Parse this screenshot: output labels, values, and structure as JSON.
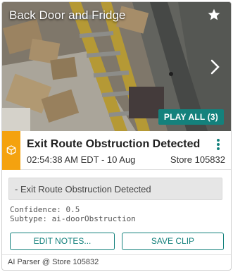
{
  "camera": {
    "title": "Back Door and Fridge",
    "play_all_label": "PLAY ALL (3)",
    "icons": {
      "favorite": "star-icon",
      "next": "chevron-right-icon"
    }
  },
  "event": {
    "title": "Exit Route Obstruction Detected",
    "time": "02:54:38 AM EDT - 10 Aug",
    "store": "Store 105832",
    "accent_color": "#f4a20f",
    "icons": {
      "type": "box-icon",
      "menu": "kebab-menu-icon"
    }
  },
  "details": {
    "notes": "- Exit Route Obstruction Detected",
    "confidence": "Confidence: 0.5",
    "subtype": "Subtype: ai-doorObstruction"
  },
  "actions": {
    "edit_notes_label": "EDIT NOTES...",
    "save_clip_label": "SAVE CLIP",
    "accent_color": "#14817c"
  },
  "footer": {
    "source": "AI Parser @ Store 105832"
  }
}
